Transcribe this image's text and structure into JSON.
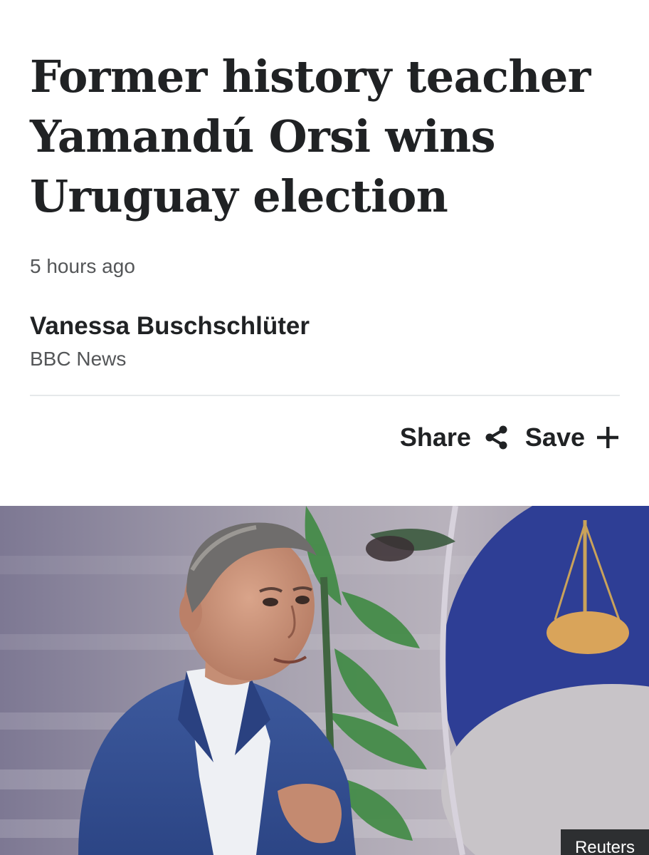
{
  "article": {
    "headline": "Former history teacher Yamandú Orsi wins Uruguay election",
    "timestamp": "5 hours ago",
    "author": "Vanessa Buschschlüter",
    "publisher": "BBC News"
  },
  "actions": {
    "share_label": "Share",
    "share_icon": "share-icon",
    "save_label": "Save",
    "save_icon": "plus-icon"
  },
  "image": {
    "credit": "Reuters"
  }
}
